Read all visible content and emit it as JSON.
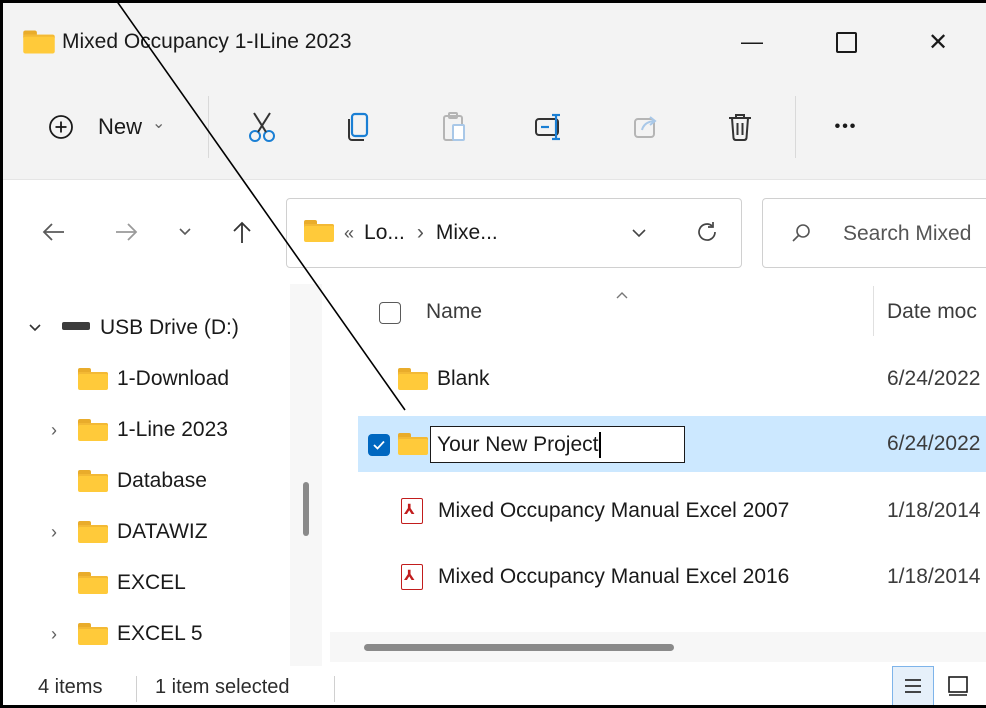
{
  "window": {
    "title": "Mixed Occupancy 1-ILine 2023",
    "minimize_glyph": "—",
    "maximize_glyph": "☐",
    "close_glyph": "✕"
  },
  "toolbar": {
    "new_label": "New",
    "new_chevron": "⌄",
    "more_glyph": "•••",
    "icons": [
      "cut-icon",
      "copy-icon",
      "paste-icon",
      "rename-icon",
      "share-icon",
      "delete-icon"
    ]
  },
  "nav": {
    "breadcrumb_overflow": "«",
    "breadcrumb_sep": "›",
    "breadcrumb": [
      "Lo...",
      "Mixe..."
    ],
    "search_placeholder": "Search Mixed"
  },
  "sidebar": {
    "items": [
      {
        "label": "USB Drive (D:)",
        "icon": "usb-drive-icon",
        "expanded": true
      },
      {
        "label": "1-Download",
        "icon": "folder-icon",
        "expandable": false
      },
      {
        "label": "1-Line 2023",
        "icon": "folder-icon",
        "expandable": true
      },
      {
        "label": "Database",
        "icon": "folder-icon",
        "expandable": false
      },
      {
        "label": "DATAWIZ",
        "icon": "folder-icon",
        "expandable": true
      },
      {
        "label": "EXCEL",
        "icon": "folder-icon",
        "expandable": false
      },
      {
        "label": "EXCEL 5",
        "icon": "folder-icon",
        "expandable": true
      }
    ]
  },
  "columns": {
    "name": "Name",
    "date_modified": "Date moc"
  },
  "files": [
    {
      "name": "Blank",
      "type": "folder",
      "date": "6/24/2022"
    },
    {
      "name": "Your New Project",
      "type": "folder",
      "date": "6/24/2022",
      "selected": true,
      "renaming": true
    },
    {
      "name": "Mixed Occupancy Manual Excel 2007",
      "type": "pdf",
      "date": "1/18/2014"
    },
    {
      "name": "Mixed Occupancy Manual Excel 2016",
      "type": "pdf",
      "date": "1/18/2014"
    }
  ],
  "status": {
    "item_count": "4 items",
    "selection": "1 item selected"
  },
  "colors": {
    "selection_bg": "#cce8ff",
    "checkbox_accent": "#0067c0",
    "folder": "#ffca3a",
    "pdf_red": "#c21d1d"
  }
}
